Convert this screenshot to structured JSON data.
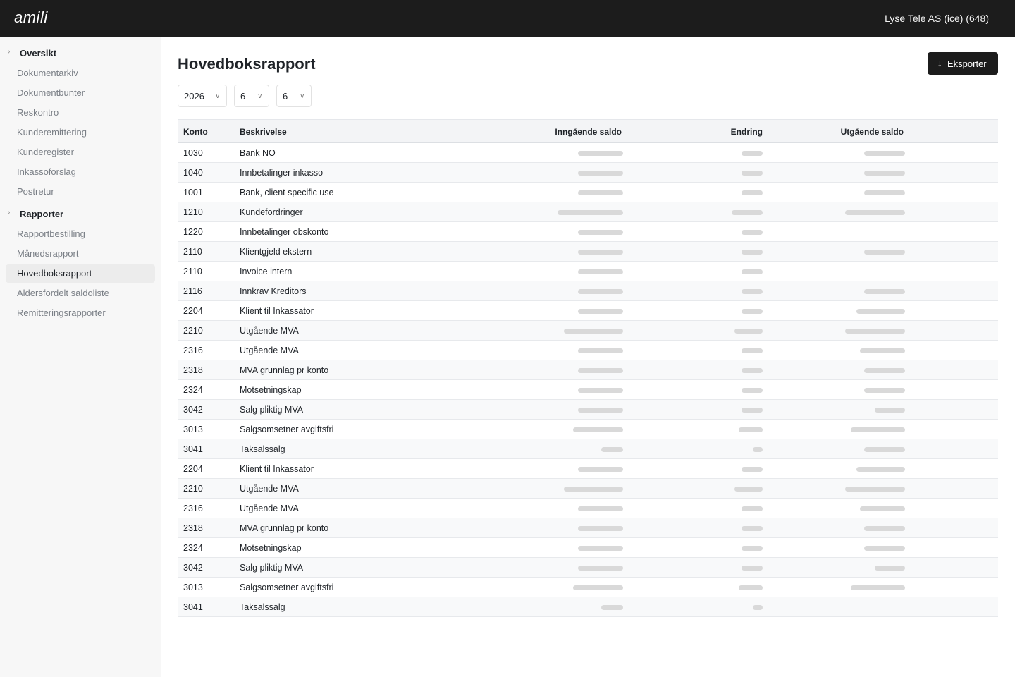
{
  "header": {
    "logo_text": "amili",
    "tenant": "Lyse Tele AS (ice) (648)"
  },
  "sidebar": {
    "sections": [
      {
        "label": "Oversikt",
        "items": [
          "Dokumentarkiv",
          "Dokumentbunter",
          "Reskontro",
          "Kunderemittering",
          "Kunderegister",
          "Inkassoforslag",
          "Postretur"
        ]
      },
      {
        "label": "Rapporter",
        "items": [
          "Rapportbestilling",
          "Månedsrapport",
          "Hovedboksrapport",
          "Aldersfordelt saldoliste",
          "Remitteringsrapporter"
        ]
      }
    ],
    "active_item": "Hovedboksrapport"
  },
  "page": {
    "title": "Hovedboksrapport",
    "export_label": "Eksporter",
    "export_icon": "arrow-down-icon",
    "filters": {
      "year": "2026",
      "from_period": "6",
      "to_period": "6"
    }
  },
  "table": {
    "columns": [
      "Konto",
      "Beskrivelse",
      "Inngående saldo",
      "Endring",
      "Utgående saldo"
    ],
    "loading": true,
    "rows": [
      {
        "konto": "1030",
        "beskrivelse": "Bank NO"
      },
      {
        "konto": "1040",
        "beskrivelse": "Innbetalinger inkasso"
      },
      {
        "konto": "1001",
        "beskrivelse": "Bank, client specific use"
      },
      {
        "konto": "1210",
        "beskrivelse": "Kundefordringer"
      },
      {
        "konto": "1220",
        "beskrivelse": "Innbetalinger obskonto"
      },
      {
        "konto": "2110",
        "beskrivelse": "Klientgjeld ekstern"
      },
      {
        "konto": "2110",
        "beskrivelse": "Invoice intern"
      },
      {
        "konto": "2116",
        "beskrivelse": "Innkrav Kreditors"
      },
      {
        "konto": "2204",
        "beskrivelse": "Klient til Inkassator"
      },
      {
        "konto": "2210",
        "beskrivelse": "Utgående MVA"
      },
      {
        "konto": "2316",
        "beskrivelse": "Utgående MVA"
      },
      {
        "konto": "2318",
        "beskrivelse": "MVA grunnlag pr konto"
      },
      {
        "konto": "2324",
        "beskrivelse": "Motsetningskap"
      },
      {
        "konto": "3042",
        "beskrivelse": "Salg pliktig MVA"
      },
      {
        "konto": "3013",
        "beskrivelse": "Salgsomsetner avgiftsfri"
      },
      {
        "konto": "3041",
        "beskrivelse": "Taksalssalg"
      },
      {
        "konto": "2204",
        "beskrivelse": "Klient til Inkassator"
      },
      {
        "konto": "2210",
        "beskrivelse": "Utgående MVA"
      },
      {
        "konto": "2316",
        "beskrivelse": "Utgående MVA"
      },
      {
        "konto": "2318",
        "beskrivelse": "MVA grunnlag pr konto"
      },
      {
        "konto": "2324",
        "beskrivelse": "Motsetningskap"
      },
      {
        "konto": "3042",
        "beskrivelse": "Salg pliktig MVA"
      },
      {
        "konto": "3013",
        "beskrivelse": "Salgsomsetner avgiftsfri"
      },
      {
        "konto": "3041",
        "beskrivelse": "Taksalssalg"
      }
    ]
  },
  "colors": {
    "topbar": "#1c1c1c",
    "sidebar_bg": "#f7f7f7",
    "skeleton": "#d9d9d9",
    "active_nav_bg": "#ececec"
  }
}
